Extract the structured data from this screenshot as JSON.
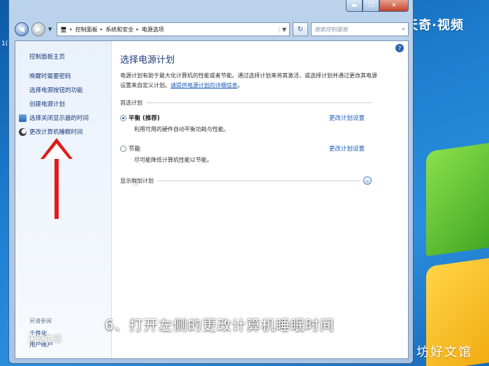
{
  "window": {
    "address": {
      "segments": [
        "控制面板",
        "系统和安全",
        "电源选项"
      ]
    },
    "search_placeholder": "搜索控制面板",
    "caption_buttons": {
      "minimize": "▬",
      "maximize": "☐",
      "close": "✕"
    }
  },
  "sidebar": {
    "home": "控制面板主页",
    "links": [
      "唤醒时需要密码",
      "选择电源按钮的功能",
      "创建电源计划",
      "选择关闭显示器的时间",
      "更改计算机睡眠时间"
    ],
    "see_also": "另请参阅",
    "bottom_links": [
      "个性化",
      "用户帐户"
    ]
  },
  "main": {
    "title": "选择电源计划",
    "description": "电源计划有助于最大化计算机的性能或者节能。通过选择计划来将其激活，或选择计划并通过更改其电源设置来自定义计划。",
    "description_link": "请提供电源计划的详细信息",
    "description_end": "。",
    "preferred_label": "首选计划",
    "plans": [
      {
        "name": "平衡 (推荐)",
        "desc": "利用可用的硬件自动平衡功耗与性能。",
        "link": "更改计划设置",
        "selected": true
      },
      {
        "name": "节能",
        "desc": "尽可能降低计算机性能以节能。",
        "link": "更改计划设置",
        "selected": false
      }
    ],
    "more_label": "显示附加计划"
  },
  "overlay": {
    "caption": "6、打开左侧的更改计算机睡眠时间",
    "arrow_color": "#e11b1b",
    "watermark_top": "天奇·视频",
    "watermark_bottom": "易坊好文馆",
    "watermark_sidebar": "天奇生活"
  },
  "desktop": {
    "fragment": "1("
  }
}
